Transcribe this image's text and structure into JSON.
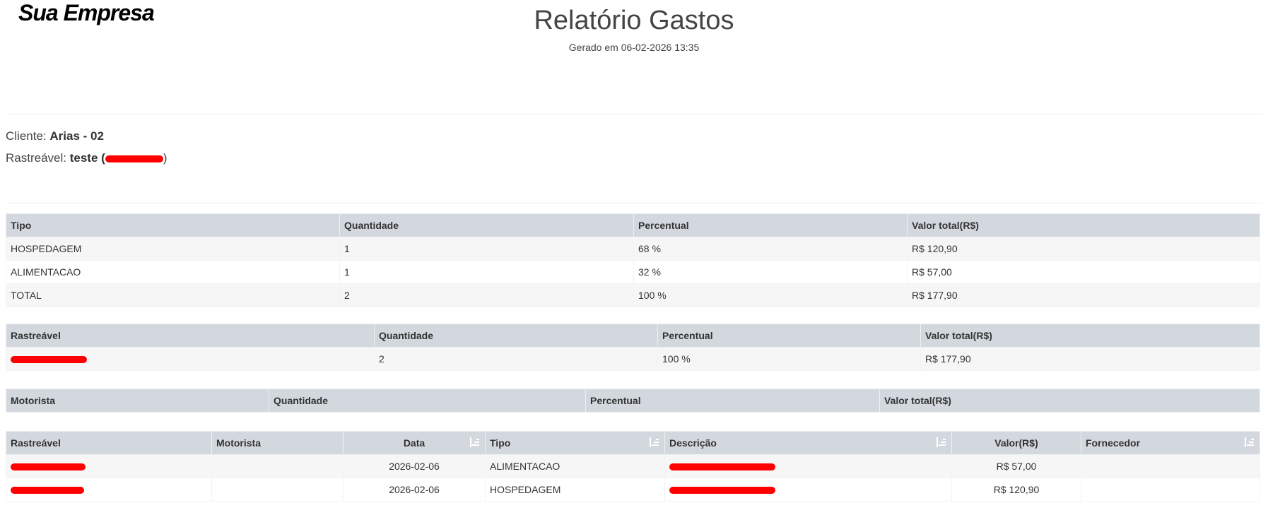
{
  "brand": {
    "logo_text": "Sua Empresa"
  },
  "header": {
    "title": "Relatório Gastos",
    "subtitle": "Gerado em 06-02-2026 13:35"
  },
  "info": {
    "client_label": "Cliente:",
    "client_value": "Arias - 02",
    "trackable_label": "Rastreável:",
    "trackable_value": "teste",
    "open_paren": "(",
    "close_paren": ")"
  },
  "type_table": {
    "headers": [
      "Tipo",
      "Quantidade",
      "Percentual",
      "Valor total(R$)"
    ],
    "rows": [
      [
        "HOSPEDAGEM",
        "1",
        "68 %",
        "R$ 120,90"
      ],
      [
        "ALIMENTACAO",
        "1",
        "32 %",
        "R$ 57,00"
      ],
      [
        "TOTAL",
        "2",
        "100 %",
        "R$ 177,90"
      ]
    ]
  },
  "trackable_table": {
    "headers": [
      "Rastreável",
      "Quantidade",
      "Percentual",
      "Valor total(R$)"
    ],
    "rows": [
      [
        "",
        "2",
        "100 %",
        "R$ 177,90"
      ]
    ]
  },
  "driver_table": {
    "headers": [
      "Motorista",
      "Quantidade",
      "Percentual",
      "Valor total(R$)"
    ]
  },
  "detail_table": {
    "headers": [
      "Rastreável",
      "Motorista",
      "Data",
      "Tipo",
      "Descrição",
      "Valor(R$)",
      "Fornecedor"
    ],
    "rows": [
      [
        "",
        "",
        "2026-02-06",
        "ALIMENTACAO",
        "",
        "R$ 57,00",
        ""
      ],
      [
        "",
        "",
        "2026-02-06",
        "HOSPEDAGEM",
        "",
        "R$ 120,90",
        ""
      ]
    ]
  },
  "colors": {
    "header_bg": "#d3d8df",
    "redaction": "#ff0000",
    "row_alt": "#f6f6f6"
  },
  "icons": {
    "sort": "sort-amount-icon"
  }
}
